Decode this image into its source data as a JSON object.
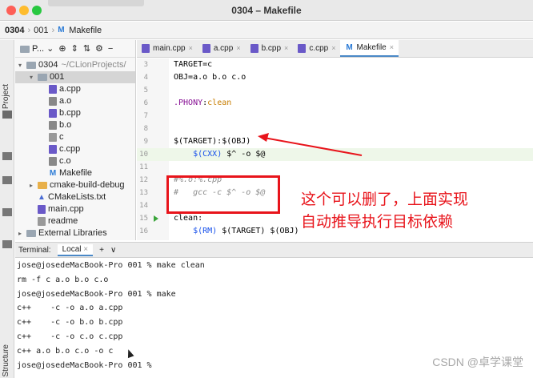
{
  "window": {
    "title": "0304 – Makefile"
  },
  "navbar": {
    "project": "0304",
    "folder": "001",
    "file": "Makefile"
  },
  "sidebar": {
    "project_label": "Project",
    "structure_label": "Structure"
  },
  "project_panel": {
    "dropdown": "P...",
    "tree": [
      {
        "label": "0304",
        "hint": "~/CLionProjects/",
        "type": "folder",
        "depth": 0,
        "expanded": true
      },
      {
        "label": "001",
        "type": "folder",
        "depth": 1,
        "expanded": true,
        "selected": true
      },
      {
        "label": "a.cpp",
        "type": "cpp",
        "depth": 2
      },
      {
        "label": "a.o",
        "type": "obj",
        "depth": 2
      },
      {
        "label": "b.cpp",
        "type": "cpp",
        "depth": 2
      },
      {
        "label": "b.o",
        "type": "obj",
        "depth": 2
      },
      {
        "label": "c",
        "type": "bin",
        "depth": 2
      },
      {
        "label": "c.cpp",
        "type": "cpp",
        "depth": 2
      },
      {
        "label": "c.o",
        "type": "obj",
        "depth": 2
      },
      {
        "label": "Makefile",
        "type": "make",
        "depth": 2
      },
      {
        "label": "cmake-build-debug",
        "type": "folder-orange",
        "depth": 1,
        "expanded": false
      },
      {
        "label": "CMakeLists.txt",
        "type": "cmake",
        "depth": 1
      },
      {
        "label": "main.cpp",
        "type": "cpp",
        "depth": 1
      },
      {
        "label": "readme",
        "type": "bin",
        "depth": 1
      },
      {
        "label": "External Libraries",
        "type": "folder",
        "depth": 0,
        "expanded": false
      }
    ]
  },
  "tabs": [
    {
      "label": "main.cpp",
      "icon": "cpp-file-icon",
      "active": false
    },
    {
      "label": "a.cpp",
      "icon": "cpp-file-icon",
      "active": false
    },
    {
      "label": "b.cpp",
      "icon": "cpp-file-icon",
      "active": false
    },
    {
      "label": "c.cpp",
      "icon": "cpp-file-icon",
      "active": false
    },
    {
      "label": "Makefile",
      "icon": "makefile-icon",
      "active": true
    }
  ],
  "editor": {
    "lines": [
      {
        "num": "3",
        "text": "TARGET=c"
      },
      {
        "num": "4",
        "text": "OBJ=a.o b.o c.o"
      },
      {
        "num": "5",
        "text": ""
      },
      {
        "num": "6",
        "text": ".PHONY:clean"
      },
      {
        "num": "7",
        "text": ""
      },
      {
        "num": "8",
        "text": ""
      },
      {
        "num": "9",
        "text": "$(TARGET):$(OBJ)"
      },
      {
        "num": "10",
        "text": "    $(CXX) $^ -o $@"
      },
      {
        "num": "11",
        "text": ""
      },
      {
        "num": "12",
        "text": "#%.o:%.cpp"
      },
      {
        "num": "13",
        "text": "#   gcc -c $^ -o $@"
      },
      {
        "num": "14",
        "text": ""
      },
      {
        "num": "15",
        "text": "clean:"
      },
      {
        "num": "16",
        "text": "    $(RM) $(TARGET) $(OBJ)"
      }
    ]
  },
  "annotation": {
    "line1": "这个可以删了，上面实现",
    "line2": "自动推导执行目标依赖",
    "color": "#e8141b"
  },
  "terminal": {
    "label": "Terminal:",
    "tab": "Local",
    "add": "+",
    "chevron": "∨",
    "lines": [
      "jose@josedeMacBook-Pro 001 % make clean",
      "rm -f c a.o b.o c.o",
      "jose@josedeMacBook-Pro 001 % make",
      "c++    -c -o a.o a.cpp",
      "c++    -c -o b.o b.cpp",
      "c++    -c -o c.o c.cpp",
      "c++ a.o b.o c.o -o c",
      "jose@josedeMacBook-Pro 001 %"
    ]
  },
  "watermark": "CSDN @卓学课堂"
}
